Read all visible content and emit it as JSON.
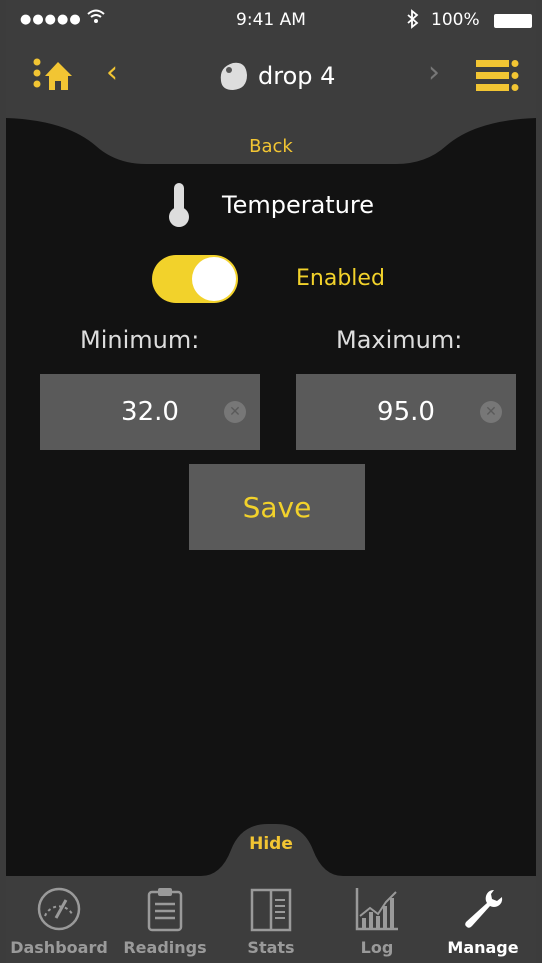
{
  "status_bar": {
    "signal": "●●●●●",
    "time": "9:41 AM",
    "battery": "100%"
  },
  "nav": {
    "title": "drop 4",
    "prev_icon": "chevron-left-icon",
    "next_icon": "chevron-right-icon"
  },
  "back_label": "Back",
  "sensor": {
    "label": "Temperature",
    "icon": "thermometer-icon"
  },
  "toggle": {
    "label": "Enabled",
    "on": true
  },
  "minimum": {
    "label": "Minimum:",
    "value": "32.0"
  },
  "maximum": {
    "label": "Maximum:",
    "value": "95.0"
  },
  "save_label": "Save",
  "hide_label": "Hide",
  "tabs": [
    {
      "label": "Dashboard",
      "icon": "gauge-icon"
    },
    {
      "label": "Readings",
      "icon": "clipboard-icon"
    },
    {
      "label": "Stats",
      "icon": "stats-icon"
    },
    {
      "label": "Log",
      "icon": "chart-icon"
    },
    {
      "label": "Manage",
      "icon": "wrench-icon",
      "active": true
    }
  ],
  "colors": {
    "accent": "#f2d22b",
    "bar": "#3d3d3d",
    "field": "#5a5a5a"
  }
}
